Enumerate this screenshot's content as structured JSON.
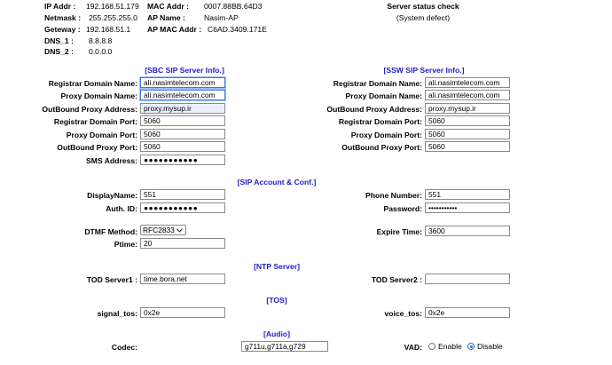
{
  "net": {
    "ip_label": "IP Addr :",
    "ip": "192.168.51.179",
    "mask_label": "Netmask :",
    "mask": "255.255.255.0",
    "gw_label": "Geteway :",
    "gw": "192.168.51.1",
    "dns1_label": "DNS_1 :",
    "dns1": "8.8.8.8",
    "dns2_label": "DNS_2 :",
    "dns2": "0.0.0.0",
    "mac_label": "MAC Addr :",
    "mac": "0007.88BB.64D3",
    "ap_name_label": "AP Name :",
    "ap_name": "Nasim-AP",
    "ap_mac_label": "AP MAC Addr :",
    "ap_mac": "C6AD.3409.171E"
  },
  "server_status": {
    "title": "Server status check",
    "value": "(System defect)"
  },
  "sbc": {
    "title": "[SBC SIP Server Info.]",
    "registrar_domain_label": "Registrar Domain Name:",
    "registrar_domain": "ali.nasimtelecom.com",
    "proxy_domain_label": "Proxy Domain Name:",
    "proxy_domain": "ali.nasimtelecom.com",
    "outbound_proxy_label": "OutBound Proxy Address:",
    "outbound_proxy": "proxy.mysup.ir",
    "registrar_port_label": "Registrar Domain Port:",
    "registrar_port": "5060",
    "proxy_port_label": "Proxy Domain Port:",
    "proxy_port": "5060",
    "outbound_port_label": "OutBound Proxy Port:",
    "outbound_port": "5060",
    "sms_label": "SMS Address:",
    "sms": "●●●●●●●●●●●"
  },
  "ssw": {
    "title": "[SSW SIP Server Info.]",
    "registrar_domain_label": "Registrar Domain Name:",
    "registrar_domain": "ali.nasimtelecom.com",
    "proxy_domain_label": "Proxy Domain Name:",
    "proxy_domain": "ali.nasimtelecom.com",
    "outbound_proxy_label": "OutBound Proxy Address:",
    "outbound_proxy": "proxy.mysup.ir",
    "registrar_port_label": "Registrar Domain Port:",
    "registrar_port": "5060",
    "proxy_port_label": "Proxy Domain Port:",
    "proxy_port": "5060",
    "outbound_port_label": "OutBound Proxy Port:",
    "outbound_port": "5060"
  },
  "account": {
    "title": "[SIP Account & Conf.]",
    "display_label": "DisplayName:",
    "display": "551",
    "auth_label": "Auth. ID:",
    "auth": "●●●●●●●●●●●",
    "phone_label": "Phone Number:",
    "phone": "551",
    "password_label": "Password:",
    "password": "•••••••••••",
    "dtmf_label": "DTMF Method:",
    "dtmf": "RFC2833",
    "ptime_label": "Ptime:",
    "ptime": "20",
    "expire_label": "Expire Time:",
    "expire": "3600"
  },
  "ntp": {
    "title": "[NTP Server]",
    "tod1_label": "TOD Server1 :",
    "tod1": "time.bora.net",
    "tod2_label": "TOD Server2 :",
    "tod2": ""
  },
  "tos": {
    "title": "[TOS]",
    "signal_label": "signal_tos:",
    "signal": "0x2e",
    "voice_label": "voice_tos:",
    "voice": "0x2e"
  },
  "audio": {
    "title": "[Audio]",
    "codec_label": "Codec:",
    "codec": "g711u,g711a,g729",
    "vad_label": "VAD:",
    "vad_enable": "Enable",
    "vad_disable": "Disable",
    "vad_selected": "Disable"
  }
}
